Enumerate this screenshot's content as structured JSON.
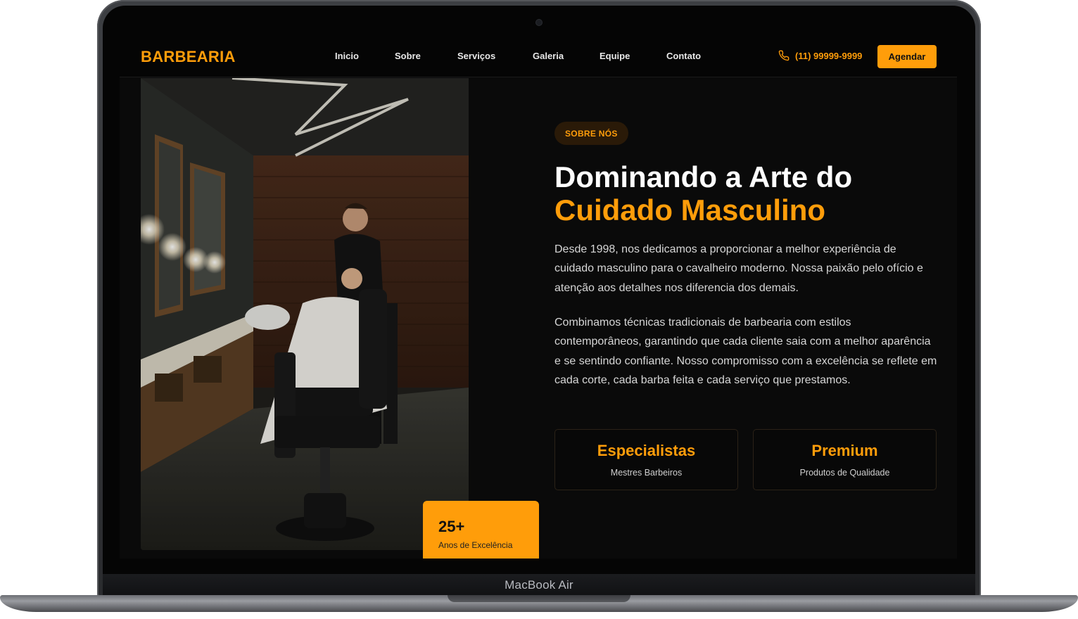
{
  "device": {
    "label": "MacBook Air"
  },
  "nav": {
    "logo": "BARBEARIA",
    "links": [
      "Inicio",
      "Sobre",
      "Serviços",
      "Galeria",
      "Equipe",
      "Contato"
    ],
    "phone": "(11) 99999-9999",
    "cta": "Agendar"
  },
  "about": {
    "tag": "SOBRE NÓS",
    "title_line1": "Dominando a Arte do",
    "title_line2": "Cuidado Masculino",
    "paragraph1": "Desde 1998, nos dedicamos a proporcionar a melhor experiência de cuidado masculino para o cavalheiro moderno. Nossa paixão pelo ofício e atenção aos detalhes nos diferencia dos demais.",
    "paragraph2": "Combinamos técnicas tradicionais de barbearia com estilos contemporâneos, garantindo que cada cliente saia com a melhor aparência e se sentindo confiante. Nosso compromisso com a excelência se reflete em cada corte, cada barba feita e cada serviço que prestamos.",
    "features": [
      {
        "title": "Especialistas",
        "subtitle": "Mestres Barbeiros"
      },
      {
        "title": "Premium",
        "subtitle": "Produtos de Qualidade"
      }
    ],
    "badge": {
      "value": "25+",
      "label": "Anos de Excelência"
    }
  },
  "colors": {
    "accent": "#ff9d0a",
    "background": "#0a0a0a",
    "text": "#ffffff"
  },
  "icons": {
    "phone": "phone-icon"
  }
}
